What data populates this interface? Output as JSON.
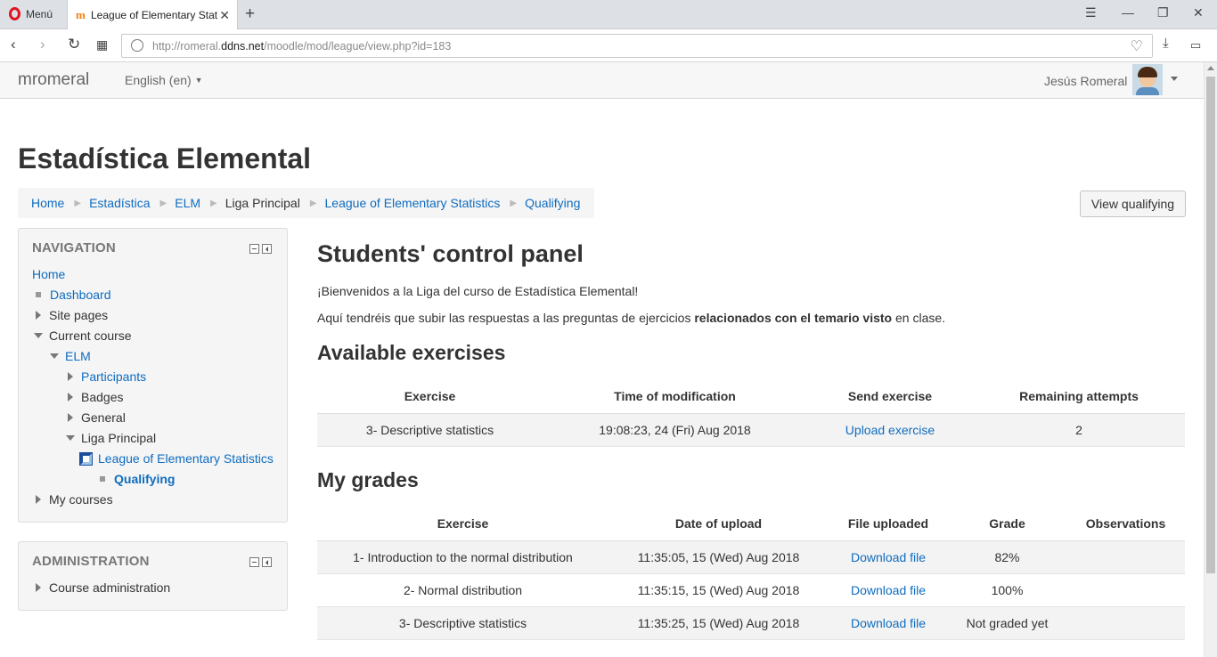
{
  "browser": {
    "menu_label": "Menú",
    "tab_title": "League of Elementary Stat",
    "url_prefix": "http://romeral.",
    "url_domain": "ddns.net",
    "url_path": "/moodle/mod/league/view.php?id=183"
  },
  "navbar": {
    "brand": "mromeral",
    "language": "English (en)",
    "user_name": "Jesús Romeral"
  },
  "page": {
    "course_title": "Estadística Elemental",
    "view_qualifying_button": "View qualifying"
  },
  "breadcrumb": [
    {
      "label": "Home",
      "link": true
    },
    {
      "label": "Estadística",
      "link": true
    },
    {
      "label": "ELM",
      "link": true
    },
    {
      "label": "Liga Principal",
      "link": false
    },
    {
      "label": "League of Elementary Statistics",
      "link": true
    },
    {
      "label": "Qualifying",
      "link": true
    }
  ],
  "navigation_block": {
    "title": "NAVIGATION",
    "items": {
      "home": "Home",
      "dashboard": "Dashboard",
      "site_pages": "Site pages",
      "current_course": "Current course",
      "elm": "ELM",
      "participants": "Participants",
      "badges": "Badges",
      "general": "General",
      "liga_principal": "Liga Principal",
      "league": "League of Elementary Statistics",
      "qualifying": "Qualifying",
      "my_courses": "My courses"
    }
  },
  "admin_block": {
    "title": "ADMINISTRATION",
    "course_admin": "Course administration"
  },
  "main": {
    "heading": "Students' control panel",
    "welcome": "¡Bienvenidos a la Liga del curso de Estadística Elemental!",
    "intro_before": "Aquí tendréis que subir las respuestas a las preguntas de ejercicios ",
    "intro_bold": "relacionados con el temario visto",
    "intro_after": " en clase.",
    "available_heading": "Available exercises",
    "grades_heading": "My grades"
  },
  "available_table": {
    "headers": [
      "Exercise",
      "Time of modification",
      "Send exercise",
      "Remaining attempts"
    ],
    "rows": [
      {
        "exercise": "3- Descriptive statistics",
        "time": "19:08:23, 24 (Fri) Aug 2018",
        "send": "Upload exercise",
        "attempts": "2"
      }
    ]
  },
  "grades_table": {
    "headers": [
      "Exercise",
      "Date of upload",
      "File uploaded",
      "Grade",
      "Observations"
    ],
    "rows": [
      {
        "exercise": "1- Introduction to the normal distribution",
        "date": "11:35:05, 15 (Wed) Aug 2018",
        "file": "Download file",
        "grade": "82%",
        "obs": ""
      },
      {
        "exercise": "2- Normal distribution",
        "date": "11:35:15, 15 (Wed) Aug 2018",
        "file": "Download file",
        "grade": "100%",
        "obs": ""
      },
      {
        "exercise": "3- Descriptive statistics",
        "date": "11:35:25, 15 (Wed) Aug 2018",
        "file": "Download file",
        "grade": "Not graded yet",
        "obs": ""
      }
    ]
  }
}
